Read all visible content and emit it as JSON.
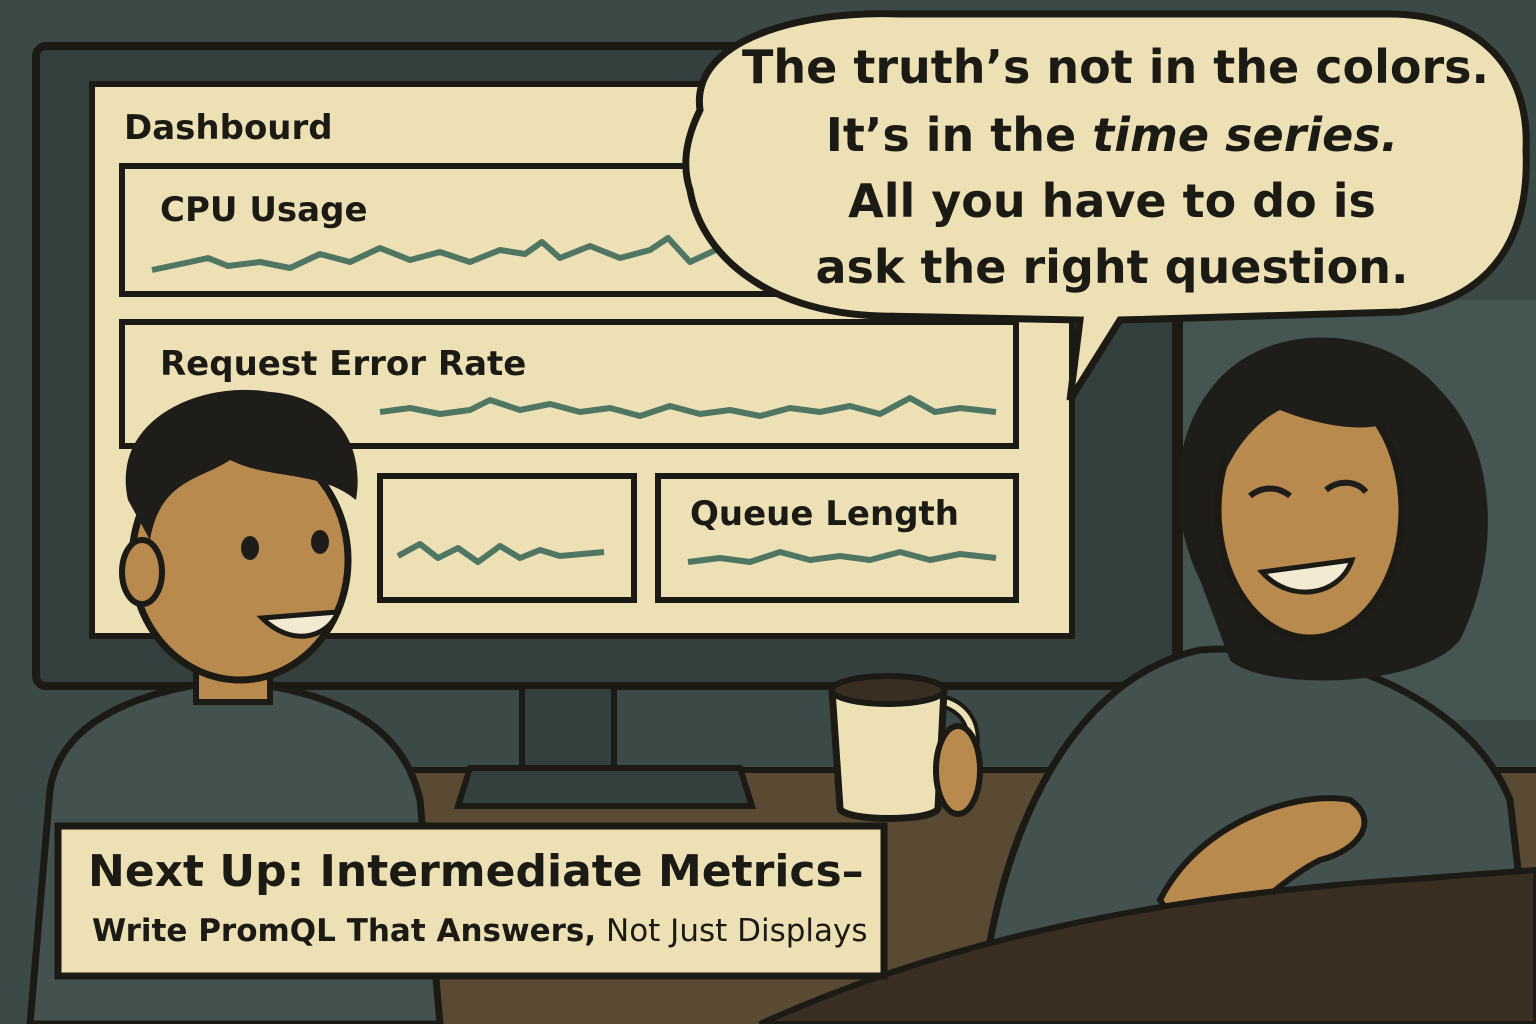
{
  "dashboard": {
    "title": "Dashbourd",
    "panels": [
      {
        "label": "CPU Usage"
      },
      {
        "label": "Request Error Rate"
      },
      {
        "label": ""
      },
      {
        "label": "Queue Length"
      }
    ]
  },
  "speech_bubble": {
    "line1": "The truth’s not in the colors.",
    "line2_prefix": "It’s in the ",
    "line2_emphasis": "time series.",
    "line3": "All you have to do is",
    "line4": "ask the right question."
  },
  "caption": {
    "title": "Next Up: Intermediate Metrics–",
    "subtitle_bold": "Write PromQL That Answers,",
    "subtitle_rest": " Not Just Displays"
  },
  "colors": {
    "wall": "#3b4a46",
    "screen": "#ede0b5",
    "sparkline": "#4f7563",
    "skin": "#b98a4e",
    "hair": "#1f1d1a",
    "shirt": "#44524f",
    "caption_bg": "#ede0b5"
  }
}
